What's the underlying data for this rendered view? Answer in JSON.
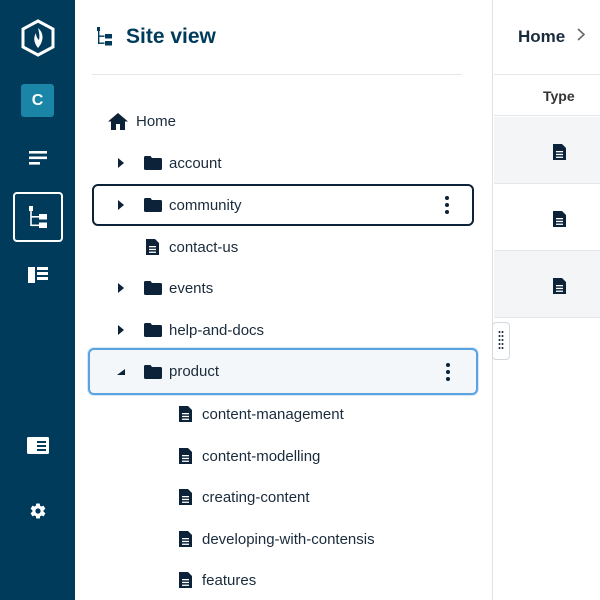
{
  "rail": {
    "avatar_letter": "C",
    "icons": [
      "contensis-logo-icon",
      "content-list-icon",
      "site-view-icon",
      "panels-icon",
      "card-icon",
      "settings-gear-icon"
    ]
  },
  "panel": {
    "title": "Site view"
  },
  "tree": {
    "home": "Home",
    "items": [
      {
        "label": "account",
        "type": "folder",
        "expanded": false
      },
      {
        "label": "community",
        "type": "folder",
        "expanded": false
      },
      {
        "label": "contact-us",
        "type": "page"
      },
      {
        "label": "events",
        "type": "folder",
        "expanded": false
      },
      {
        "label": "help-and-docs",
        "type": "folder",
        "expanded": false
      },
      {
        "label": "product",
        "type": "folder",
        "expanded": true
      }
    ],
    "children": [
      {
        "label": "content-management",
        "type": "page"
      },
      {
        "label": "content-modelling",
        "type": "page"
      },
      {
        "label": "creating-content",
        "type": "page"
      },
      {
        "label": "developing-with-contensis",
        "type": "page"
      },
      {
        "label": "features",
        "type": "page"
      }
    ]
  },
  "content": {
    "breadcrumb": "Home",
    "column_type": "Type"
  },
  "colors": {
    "rail": "#003b5c",
    "accent": "#1a85a6",
    "selected_border": "#5aa3e0"
  }
}
